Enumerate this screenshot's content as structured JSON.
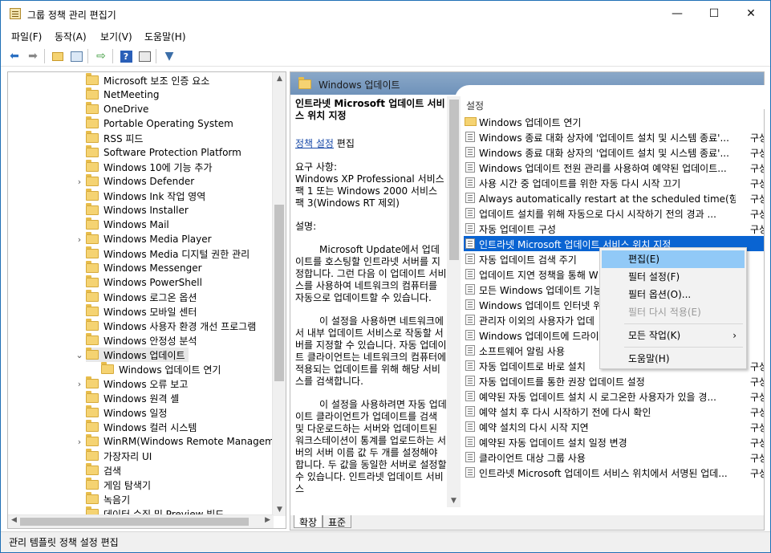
{
  "window": {
    "title": "그룹 정책 관리 편집기",
    "minimize": "—",
    "maximize": "☐",
    "close": "✕"
  },
  "menu": [
    "파일(F)",
    "동작(A)",
    "보기(V)",
    "도움말(H)"
  ],
  "toolbar": {
    "icons": [
      "back-icon",
      "forward-icon",
      "up-folder-icon",
      "show-tree-icon",
      "export-icon",
      "help-icon",
      "properties-icon",
      "filter-icon"
    ]
  },
  "tree": {
    "items": [
      {
        "label": "Microsoft 보조 인증 요소",
        "expander": ""
      },
      {
        "label": "NetMeeting",
        "expander": ""
      },
      {
        "label": "OneDrive",
        "expander": ""
      },
      {
        "label": "Portable Operating System",
        "expander": ""
      },
      {
        "label": "RSS 피드",
        "expander": ""
      },
      {
        "label": "Software Protection Platform",
        "expander": ""
      },
      {
        "label": "Windows 10에 기능 추가",
        "expander": ""
      },
      {
        "label": "Windows Defender",
        "expander": ">"
      },
      {
        "label": "Windows Ink 작업 영역",
        "expander": ""
      },
      {
        "label": "Windows Installer",
        "expander": ""
      },
      {
        "label": "Windows Mail",
        "expander": ""
      },
      {
        "label": "Windows Media Player",
        "expander": ">"
      },
      {
        "label": "Windows Media 디지털 권한 관리",
        "expander": ""
      },
      {
        "label": "Windows Messenger",
        "expander": ""
      },
      {
        "label": "Windows PowerShell",
        "expander": ""
      },
      {
        "label": "Windows 로그온 옵션",
        "expander": ""
      },
      {
        "label": "Windows 모바일 센터",
        "expander": ""
      },
      {
        "label": "Windows 사용자 환경 개선 프로그램",
        "expander": ""
      },
      {
        "label": "Windows 안정성 분석",
        "expander": ""
      },
      {
        "label": "Windows 업데이트",
        "expander": "v"
      },
      {
        "label": "Windows 업데이트 연기",
        "expander": ""
      },
      {
        "label": "Windows 오류 보고",
        "expander": ">"
      },
      {
        "label": "Windows 원격 셸",
        "expander": ""
      },
      {
        "label": "Windows 일정",
        "expander": ""
      },
      {
        "label": "Windows 컬러 시스템",
        "expander": ""
      },
      {
        "label": "WinRM(Windows Remote Managemen",
        "expander": ">"
      },
      {
        "label": "가장자리 UI",
        "expander": ""
      },
      {
        "label": "검색",
        "expander": ""
      },
      {
        "label": "게임 탐색기",
        "expander": ""
      },
      {
        "label": "녹음기",
        "expander": ""
      },
      {
        "label": "데이터 수집 및 Preview 빌드",
        "expander": ""
      }
    ]
  },
  "header": {
    "title": "Windows 업데이트"
  },
  "description": {
    "title": "인트라넷 Microsoft 업데이트 서비스 위치 지정",
    "edit_link": "정책 설정",
    "edit_suffix": " 편집",
    "requirements_label": "요구 사항:",
    "requirements": "Windows XP Professional 서비스 팩 1 또는 Windows 2000 서비스 팩 3(Windows RT 제외)",
    "desc_label": "설명:",
    "p1": "Microsoft Update에서 업데이트를 호스팅할 인트라넷 서버를 지정합니다. 그런 다음 이 업데이트 서비스를 사용하여 네트워크의 컴퓨터를 자동으로 업데이트할 수 있습니다.",
    "p2": "이 설정을 사용하면 네트워크에서 내부 업데이트 서비스로 작동할 서버를 지정할 수 있습니다. 자동 업데이트 클라이언트는 네트워크의 컴퓨터에 적용되는 업데이트를 위해 해당 서비스를 검색합니다.",
    "p3": "이 설정을 사용하려면 자동 업데이트 클라이언트가 업데이트를 검색 및 다운로드하는 서버와 업데이트된 워크스테이션이 통계를 업로드하는 서버의 서버 이름 값 두 개를 설정해야 합니다. 두 값을 동일한 서버로 설정할 수 있습니다. 인트라넷 업데이트 서비스"
  },
  "list": {
    "header": "설정",
    "rows": [
      {
        "text": "Windows 업데이트 연기",
        "state": "",
        "type": "folder"
      },
      {
        "text": "Windows 종료 대화 상자에 '업데이트 설치 및 시스템 종료'...",
        "state": "구성",
        "type": "policy"
      },
      {
        "text": "Windows 종료 대화 상자의 '업데이트 설치 및 시스템 종료'...",
        "state": "구성",
        "type": "policy"
      },
      {
        "text": "Windows 업데이트 전원 관리를 사용하여 예약된 업데이트...",
        "state": "구성",
        "type": "policy"
      },
      {
        "text": "사용 시간 중 업데이트를 위한 자동 다시 시작 끄기",
        "state": "구성",
        "type": "policy"
      },
      {
        "text": "Always automatically restart at the scheduled time(항상 예...",
        "state": "구성",
        "type": "policy"
      },
      {
        "text": "업데이트 설치를 위해 자동으로 다시 시작하기 전의 경과 ...",
        "state": "구성",
        "type": "policy"
      },
      {
        "text": "자동 업데이트 구성",
        "state": "구성",
        "type": "policy"
      },
      {
        "text": "인트라넷 Microsoft 업데이트 서비스 위치 지정",
        "state": "",
        "type": "policy"
      },
      {
        "text": "자동 업데이트 검색 주기",
        "state": "",
        "type": "policy"
      },
      {
        "text": "업데이트 지연 정책을 통해 W",
        "state": "",
        "type": "policy"
      },
      {
        "text": "모든 Windows 업데이트 기능",
        "state": "",
        "type": "policy"
      },
      {
        "text": "Windows 업데이트 인터넷 위",
        "state": "",
        "type": "policy"
      },
      {
        "text": "관리자 이외의 사용자가 업데",
        "state": "",
        "type": "policy"
      },
      {
        "text": "Windows 업데이트에 드라이",
        "state": "",
        "type": "policy"
      },
      {
        "text": "소프트웨어 알림 사용",
        "state": "",
        "type": "policy"
      },
      {
        "text": "자동 업데이트로 바로 설치",
        "state": "구성",
        "type": "policy"
      },
      {
        "text": "자동 업데이트를 통한 권장 업데이트 설정",
        "state": "구성",
        "type": "policy"
      },
      {
        "text": "예약된 자동 업데이트 설치 시 로그온한 사용자가 있을 경...",
        "state": "구성",
        "type": "policy"
      },
      {
        "text": "예약 설치 후 다시 시작하기 전에 다시 확인",
        "state": "구성",
        "type": "policy"
      },
      {
        "text": "예약 설치의 다시 시작 지연",
        "state": "구성",
        "type": "policy"
      },
      {
        "text": "예약된 자동 업데이트 설치 일정 변경",
        "state": "구성",
        "type": "policy"
      },
      {
        "text": "클라이언트 대상 그룹 사용",
        "state": "구성",
        "type": "policy"
      },
      {
        "text": "인트라넷 Microsoft 업데이트 서비스 위치에서 서명된 업데...",
        "state": "구성",
        "type": "policy"
      }
    ]
  },
  "context_menu": {
    "edit": "편집(E)",
    "filter_on": "필터 설정(F)",
    "filter_options": "필터 옵션(O)...",
    "reapply_filter": "필터 다시 적용(E)",
    "all_tasks": "모든 작업(K)",
    "help": "도움말(H)"
  },
  "tabs": {
    "extended": "확장",
    "standard": "표준"
  },
  "status": {
    "text": "관리 템플릿 정책 설정 편집"
  },
  "colors": {
    "selection": "#0a64d2",
    "header_band": "#7898be",
    "context_highlight": "#91c9f7"
  }
}
